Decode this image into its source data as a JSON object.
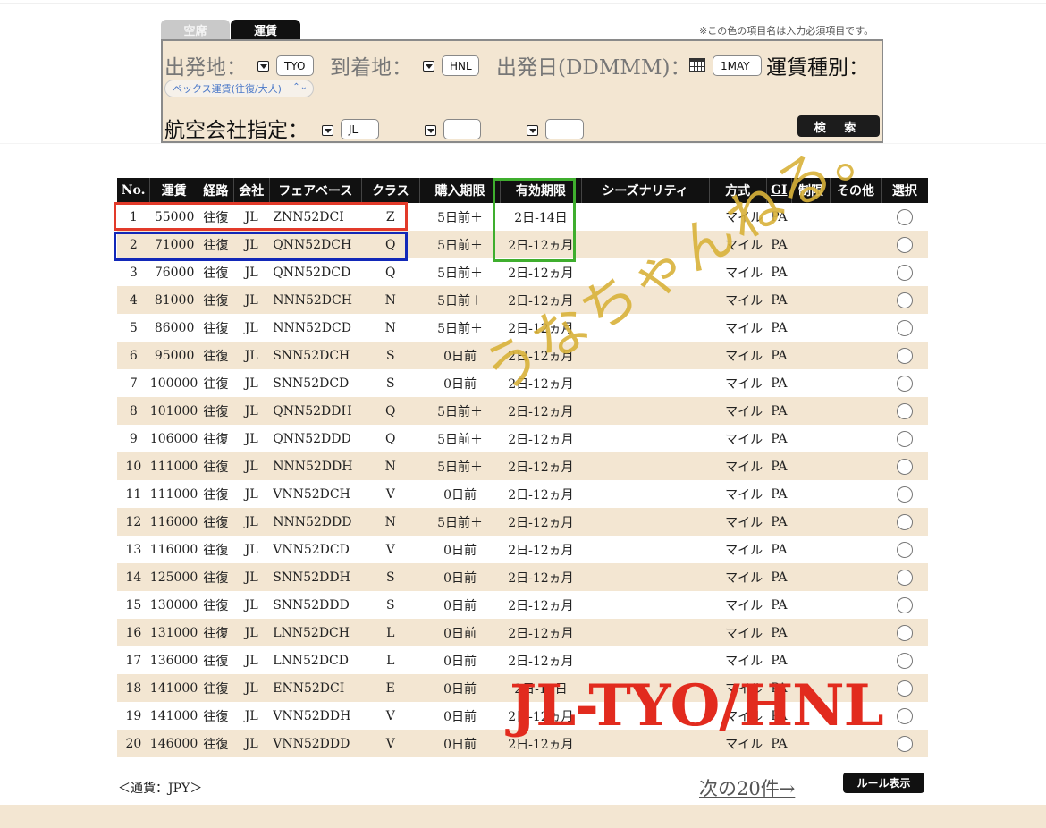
{
  "tabs": {
    "availability": "空席",
    "fare": "運賃"
  },
  "required_note": "※この色の項目名は入力必須項目です。",
  "search": {
    "origin_label": "出発地：",
    "origin_value": "TYO",
    "destination_label": "到着地：",
    "destination_value": "HNL",
    "date_label": "出発日(DDMMM)：",
    "date_value": "1MAY",
    "fare_type_label": "運賃種別：",
    "fare_type_value": "ペックス運賃(往復/大人)",
    "airline_label": "航空会社指定：",
    "airline_values": [
      "JL",
      "",
      ""
    ],
    "search_button": "検 索"
  },
  "table": {
    "headers": [
      "No.",
      "運賃",
      "経路",
      "会社",
      "フェアベース",
      "クラス",
      "購入期限",
      "有効期限",
      "シーズナリティ",
      "方式",
      "GI",
      "制限",
      "その他",
      "選択"
    ],
    "rows": [
      {
        "no": "1",
        "fare": "55000",
        "route": "往復",
        "carrier": "JL",
        "basis": "ZNN52DCI",
        "cls": "Z",
        "purchase": "5日前＋",
        "validity": "2日-14日",
        "season": "",
        "method": "マイル",
        "gi": "PA",
        "restrict": "",
        "other": ""
      },
      {
        "no": "2",
        "fare": "71000",
        "route": "往復",
        "carrier": "JL",
        "basis": "QNN52DCH",
        "cls": "Q",
        "purchase": "5日前＋",
        "validity": "2日-12ヵ月",
        "season": "",
        "method": "マイル",
        "gi": "PA",
        "restrict": "",
        "other": ""
      },
      {
        "no": "3",
        "fare": "76000",
        "route": "往復",
        "carrier": "JL",
        "basis": "QNN52DCD",
        "cls": "Q",
        "purchase": "5日前＋",
        "validity": "2日-12ヵ月",
        "season": "",
        "method": "マイル",
        "gi": "PA",
        "restrict": "",
        "other": ""
      },
      {
        "no": "4",
        "fare": "81000",
        "route": "往復",
        "carrier": "JL",
        "basis": "NNN52DCH",
        "cls": "N",
        "purchase": "5日前＋",
        "validity": "2日-12ヵ月",
        "season": "",
        "method": "マイル",
        "gi": "PA",
        "restrict": "",
        "other": ""
      },
      {
        "no": "5",
        "fare": "86000",
        "route": "往復",
        "carrier": "JL",
        "basis": "NNN52DCD",
        "cls": "N",
        "purchase": "5日前＋",
        "validity": "2日-12ヵ月",
        "season": "",
        "method": "マイル",
        "gi": "PA",
        "restrict": "",
        "other": ""
      },
      {
        "no": "6",
        "fare": "95000",
        "route": "往復",
        "carrier": "JL",
        "basis": "SNN52DCH",
        "cls": "S",
        "purchase": "0日前",
        "validity": "2日-12ヵ月",
        "season": "",
        "method": "マイル",
        "gi": "PA",
        "restrict": "",
        "other": ""
      },
      {
        "no": "7",
        "fare": "100000",
        "route": "往復",
        "carrier": "JL",
        "basis": "SNN52DCD",
        "cls": "S",
        "purchase": "0日前",
        "validity": "2日-12ヵ月",
        "season": "",
        "method": "マイル",
        "gi": "PA",
        "restrict": "",
        "other": ""
      },
      {
        "no": "8",
        "fare": "101000",
        "route": "往復",
        "carrier": "JL",
        "basis": "QNN52DDH",
        "cls": "Q",
        "purchase": "5日前＋",
        "validity": "2日-12ヵ月",
        "season": "",
        "method": "マイル",
        "gi": "PA",
        "restrict": "",
        "other": ""
      },
      {
        "no": "9",
        "fare": "106000",
        "route": "往復",
        "carrier": "JL",
        "basis": "QNN52DDD",
        "cls": "Q",
        "purchase": "5日前＋",
        "validity": "2日-12ヵ月",
        "season": "",
        "method": "マイル",
        "gi": "PA",
        "restrict": "",
        "other": ""
      },
      {
        "no": "10",
        "fare": "111000",
        "route": "往復",
        "carrier": "JL",
        "basis": "NNN52DDH",
        "cls": "N",
        "purchase": "5日前＋",
        "validity": "2日-12ヵ月",
        "season": "",
        "method": "マイル",
        "gi": "PA",
        "restrict": "",
        "other": ""
      },
      {
        "no": "11",
        "fare": "111000",
        "route": "往復",
        "carrier": "JL",
        "basis": "VNN52DCH",
        "cls": "V",
        "purchase": "0日前",
        "validity": "2日-12ヵ月",
        "season": "",
        "method": "マイル",
        "gi": "PA",
        "restrict": "",
        "other": ""
      },
      {
        "no": "12",
        "fare": "116000",
        "route": "往復",
        "carrier": "JL",
        "basis": "NNN52DDD",
        "cls": "N",
        "purchase": "5日前＋",
        "validity": "2日-12ヵ月",
        "season": "",
        "method": "マイル",
        "gi": "PA",
        "restrict": "",
        "other": ""
      },
      {
        "no": "13",
        "fare": "116000",
        "route": "往復",
        "carrier": "JL",
        "basis": "VNN52DCD",
        "cls": "V",
        "purchase": "0日前",
        "validity": "2日-12ヵ月",
        "season": "",
        "method": "マイル",
        "gi": "PA",
        "restrict": "",
        "other": ""
      },
      {
        "no": "14",
        "fare": "125000",
        "route": "往復",
        "carrier": "JL",
        "basis": "SNN52DDH",
        "cls": "S",
        "purchase": "0日前",
        "validity": "2日-12ヵ月",
        "season": "",
        "method": "マイル",
        "gi": "PA",
        "restrict": "",
        "other": ""
      },
      {
        "no": "15",
        "fare": "130000",
        "route": "往復",
        "carrier": "JL",
        "basis": "SNN52DDD",
        "cls": "S",
        "purchase": "0日前",
        "validity": "2日-12ヵ月",
        "season": "",
        "method": "マイル",
        "gi": "PA",
        "restrict": "",
        "other": ""
      },
      {
        "no": "16",
        "fare": "131000",
        "route": "往復",
        "carrier": "JL",
        "basis": "LNN52DCH",
        "cls": "L",
        "purchase": "0日前",
        "validity": "2日-12ヵ月",
        "season": "",
        "method": "マイル",
        "gi": "PA",
        "restrict": "",
        "other": ""
      },
      {
        "no": "17",
        "fare": "136000",
        "route": "往復",
        "carrier": "JL",
        "basis": "LNN52DCD",
        "cls": "L",
        "purchase": "0日前",
        "validity": "2日-12ヵ月",
        "season": "",
        "method": "マイル",
        "gi": "PA",
        "restrict": "",
        "other": ""
      },
      {
        "no": "18",
        "fare": "141000",
        "route": "往復",
        "carrier": "JL",
        "basis": "ENN52DCI",
        "cls": "E",
        "purchase": "0日前",
        "validity": "2日-14日",
        "season": "",
        "method": "マイル",
        "gi": "PA",
        "restrict": "",
        "other": ""
      },
      {
        "no": "19",
        "fare": "141000",
        "route": "往復",
        "carrier": "JL",
        "basis": "VNN52DDH",
        "cls": "V",
        "purchase": "0日前",
        "validity": "2日-12ヵ月",
        "season": "",
        "method": "マイル",
        "gi": "PA",
        "restrict": "",
        "other": ""
      },
      {
        "no": "20",
        "fare": "146000",
        "route": "往復",
        "carrier": "JL",
        "basis": "VNN52DDD",
        "cls": "V",
        "purchase": "0日前",
        "validity": "2日-12ヵ月",
        "season": "",
        "method": "マイル",
        "gi": "PA",
        "restrict": "",
        "other": ""
      }
    ]
  },
  "footer": {
    "currency": "＜通貨：JPY＞",
    "next_link": "次の20件→",
    "rule_button": "ルール表示"
  },
  "overlay": {
    "watermark": "うなちゃんねる。",
    "route_title": "JL-TYO/HNL"
  },
  "colors": {
    "header_bg": "#111111",
    "row_alt": "#f3e6d2",
    "highlight_red": "#e23a2a",
    "highlight_blue": "#1228b8",
    "highlight_green": "#3fae2e",
    "title_red": "#e22b1e",
    "watermark_gold": "#d9b23a"
  }
}
